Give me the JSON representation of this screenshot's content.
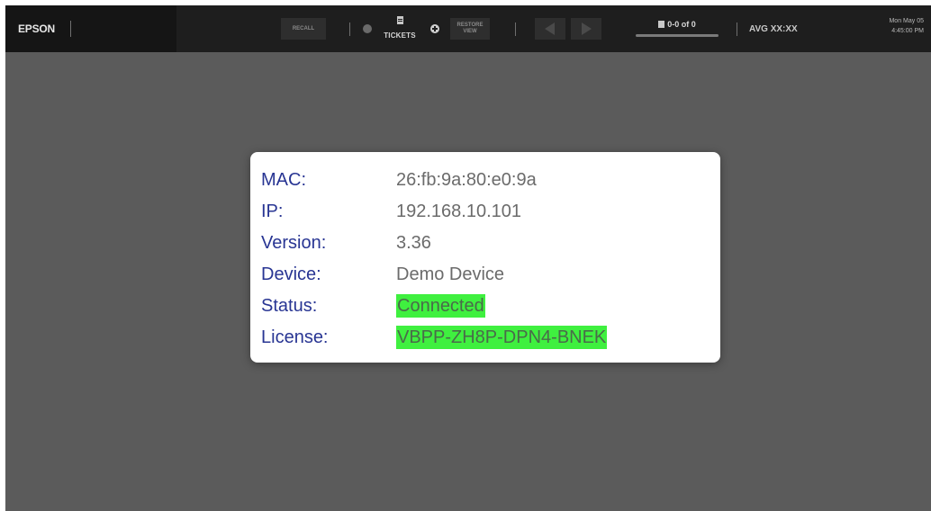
{
  "topbar": {
    "logo": "EPSON",
    "recall_label": "RECALL",
    "tickets_label": "TICKETS",
    "restore_label_1": "RESTORE",
    "restore_label_2": "VIEW",
    "pager_text": "0-0 of 0",
    "avg_text": "AVG XX:XX",
    "date_text": "Mon May 05",
    "time_text": "4:45:00 PM"
  },
  "info": {
    "rows": [
      {
        "label": "MAC:",
        "value": "26:fb:9a:80:e0:9a",
        "highlight": false
      },
      {
        "label": "IP:",
        "value": "192.168.10.101",
        "highlight": false
      },
      {
        "label": "Version:",
        "value": "3.36",
        "highlight": false
      },
      {
        "label": "Device:",
        "value": "Demo Device",
        "highlight": false
      },
      {
        "label": "Status:",
        "value": "Connected",
        "highlight": true
      },
      {
        "label": "License:",
        "value": "VBPP-ZH8P-DPN4-BNEK",
        "highlight": true
      }
    ]
  },
  "colors": {
    "background": "#5b5b5b",
    "topbar": "#1e1e1e",
    "label_text": "#283593",
    "value_text": "#6b6b6b",
    "highlight": "#3ff03f"
  },
  "icons": {
    "tickets": "ticket-icon",
    "prev": "arrow-left-icon",
    "next": "arrow-right-icon",
    "add": "plus-circle-icon",
    "pager": "document-icon"
  }
}
